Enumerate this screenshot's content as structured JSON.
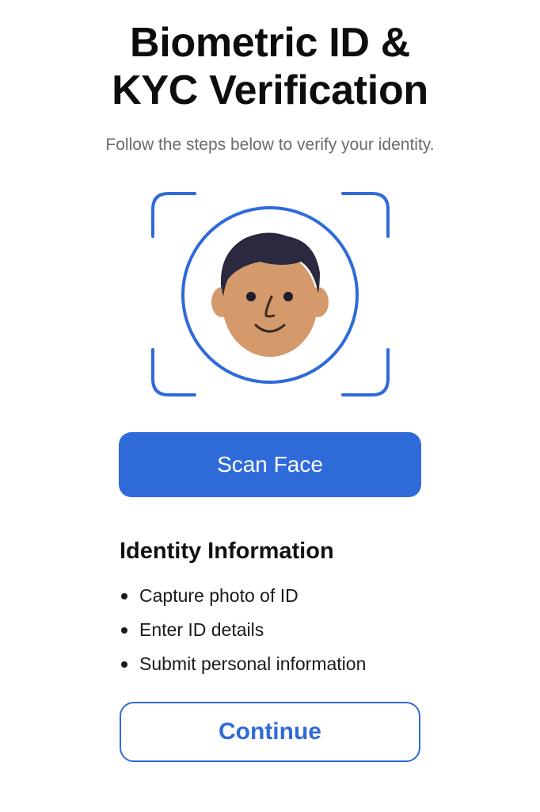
{
  "header": {
    "title_line1": "Biometric ID &",
    "title_line2": "KYC Verification",
    "subtitle": "Follow the steps below to verify your identity."
  },
  "scanner": {
    "frame_icon": "face-scan-frame-icon",
    "avatar_icon": "face-avatar-icon"
  },
  "actions": {
    "scan_label": "Scan Face",
    "continue_label": "Continue"
  },
  "identity": {
    "heading": "Identity Information",
    "items": [
      {
        "label": "Capture photo of ID"
      },
      {
        "label": "Enter ID details"
      },
      {
        "label": "Submit personal information"
      }
    ]
  },
  "colors": {
    "accent": "#2f6ad9",
    "skin": "#d49a6c",
    "hair": "#2a2940",
    "subtitle": "#6b6b6b"
  }
}
